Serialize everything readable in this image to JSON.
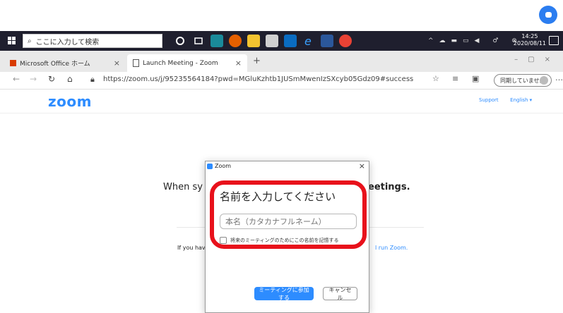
{
  "taskbar": {
    "search_placeholder": "ここに入力して検索",
    "time": "14:25",
    "date": "2020/08/11"
  },
  "browser": {
    "tabs": [
      {
        "label": "Microsoft Office ホーム"
      },
      {
        "label": "Launch Meeting - Zoom"
      }
    ],
    "url": "https://zoom.us/j/95235564184?pwd=MGluKzhtb1JUSmMwenIzSXcyb05Gdz09#success",
    "sync_label": "同期していません"
  },
  "zoom_page": {
    "logo": "zoom",
    "support_link": "Support",
    "language_link": "English ▾",
    "bg_text_left": "When sy",
    "bg_text_right": "eetings.",
    "bg_line2_left": "If you have",
    "bg_line2_right": "l run Zoom."
  },
  "dialog": {
    "title": "Zoom",
    "heading": "名前を入力してください",
    "name_placeholder": "本名（カタカナフルネーム）",
    "remember_label": "将来のミーティングのためにこの名前を記憶する",
    "join_label": "ミーティングに参加する",
    "cancel_label": "キャンセル"
  },
  "colors": {
    "accent": "#2d8cff",
    "highlight": "#e8111b"
  }
}
